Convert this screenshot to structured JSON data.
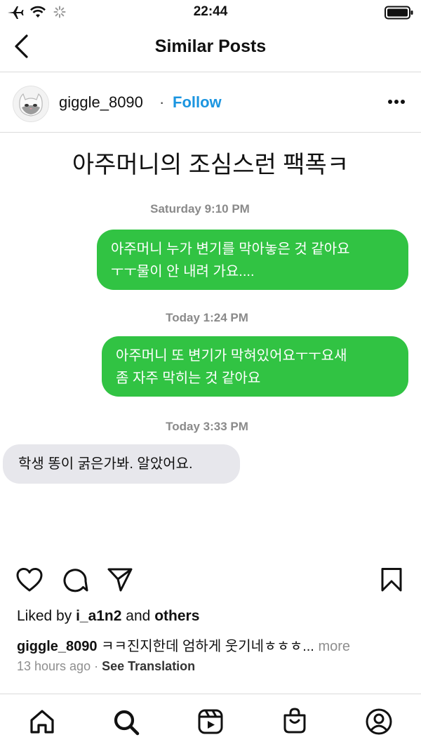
{
  "status_bar": {
    "time": "22:44"
  },
  "nav": {
    "title": "Similar Posts"
  },
  "post": {
    "username": "giggle_8090",
    "separator": "·",
    "follow_label": "Follow",
    "image": {
      "headline": "아주머니의 조심스런 팩폭ㅋ",
      "messages": [
        {
          "timestamp": "Saturday 9:10 PM",
          "lines": [
            "아주머니 누가 변기를 막아놓은 것 같아요",
            "ㅜㅜ물이 안 내려 가요...."
          ]
        },
        {
          "timestamp": "Today 1:24 PM",
          "lines": [
            "아주머니 또 변기가 막혀있어요ㅜㅜ요새",
            "좀 자주 막히는 것 같아요"
          ]
        },
        {
          "timestamp": "Today 3:33 PM",
          "lines": [
            "학생 똥이 굵은가봐. 알았어요."
          ]
        }
      ]
    },
    "likes": {
      "prefix": "Liked by",
      "user": "i_a1n2",
      "and": "and",
      "others": "others"
    },
    "caption": {
      "user": "giggle_8090",
      "text": "ㅋㅋ진지한데 엄하게 웃기네ㅎㅎㅎ...",
      "more": "more"
    },
    "time_ago": "13 hours ago",
    "meta_separator": "·",
    "see_translation": "See Translation"
  },
  "colors": {
    "link": "#1b95e0",
    "bubble_green": "#31c343",
    "bubble_grey": "#e7e7ec"
  },
  "icons": {
    "status": [
      "airplane-icon",
      "wifi-icon",
      "activity-spinner-icon",
      "battery-icon"
    ],
    "nav": [
      "back-chevron-icon"
    ],
    "post_actions": [
      "like-heart-icon",
      "comment-icon",
      "share-icon",
      "save-bookmark-icon"
    ],
    "tab_bar": [
      "home-icon",
      "search-icon",
      "reels-icon",
      "shop-icon",
      "profile-icon"
    ]
  }
}
